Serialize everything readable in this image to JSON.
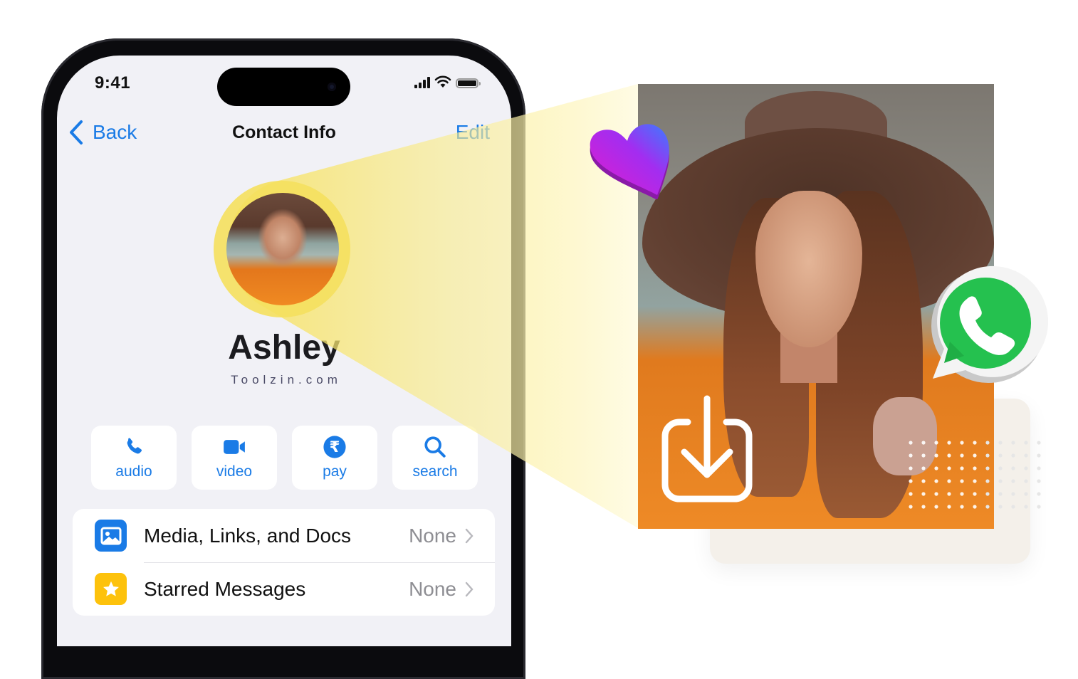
{
  "status_bar": {
    "time": "9:41",
    "icons": [
      "cellular-signal-icon",
      "wifi-icon",
      "battery-icon"
    ]
  },
  "nav": {
    "back_label": "Back",
    "title": "Contact Info",
    "edit_label": "Edit"
  },
  "contact": {
    "name": "Ashley",
    "watermark": "Toolzin.com"
  },
  "actions": [
    {
      "label": "audio",
      "icon": "phone-icon"
    },
    {
      "label": "video",
      "icon": "video-camera-icon"
    },
    {
      "label": "pay",
      "icon": "rupee-icon"
    },
    {
      "label": "search",
      "icon": "search-icon"
    }
  ],
  "list": [
    {
      "label": "Media, Links, and Docs",
      "value": "None",
      "icon": "photo-icon",
      "icon_color": "#1a7be6"
    },
    {
      "label": "Starred Messages",
      "value": "None",
      "icon": "star-icon",
      "icon_color": "#fdc20c"
    }
  ],
  "colors": {
    "accent_blue": "#1a7be6",
    "beam_yellow": "#f7e46a",
    "whatsapp_green": "#25c14f",
    "heart_gradient": [
      "#d21fd8",
      "#3f7bff"
    ]
  },
  "decorations": {
    "heart": "heart-icon",
    "whatsapp": "whatsapp-logo-icon",
    "download": "download-icon"
  }
}
